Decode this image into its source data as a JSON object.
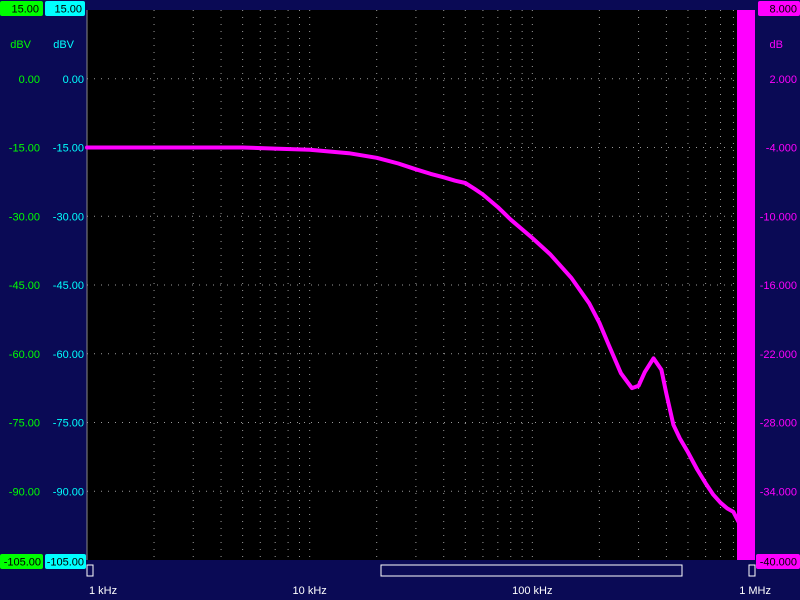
{
  "axes": {
    "left_green": {
      "unit": "dBV",
      "top_badge": "15.00",
      "bottom_badge": "-105.00",
      "ticks": [
        "0.00",
        "-15.00",
        "-30.00",
        "-45.00",
        "-60.00",
        "-75.00",
        "-90.00"
      ]
    },
    "left_cyan": {
      "unit": "dBV",
      "top_badge": "15.00",
      "bottom_badge": "-105.00",
      "ticks": [
        "0.00",
        "-15.00",
        "-30.00",
        "-45.00",
        "-60.00",
        "-75.00",
        "-90.00"
      ]
    },
    "right_magenta": {
      "unit": "dB",
      "top_badge": "8.000",
      "bottom_badge": "-40.000",
      "ticks": [
        "2.000",
        "-4.000",
        "-10.000",
        "-16.000",
        "-22.000",
        "-28.000",
        "-34.000"
      ]
    },
    "x": {
      "tick_labels": [
        "1 kHz",
        "10 kHz",
        "100 kHz",
        "1 MHz"
      ]
    }
  },
  "colors": {
    "background": "#0a0a55",
    "plot_bg": "#000000",
    "green": "#00ff00",
    "cyan": "#00ffff",
    "magenta": "#ff00ff",
    "grid": "#9a9a9a"
  },
  "chart_data": {
    "type": "line",
    "x_scale": "log",
    "xlim": [
      1000,
      1000000
    ],
    "ylim_dB": [
      -40,
      8
    ],
    "ylim_dBV": [
      -105,
      15
    ],
    "series": [
      {
        "x": [
          1000,
          1500,
          2000,
          3000,
          5000,
          7000,
          10000,
          15000,
          20000,
          25000,
          30000,
          35000,
          40000,
          45000,
          50000,
          55000,
          60000,
          70000,
          80000,
          100000,
          120000,
          150000,
          180000,
          200000,
          220000,
          250000,
          280000,
          300000,
          320000,
          350000,
          380000,
          400000,
          430000,
          460000,
          500000,
          550000,
          600000,
          650000,
          700000,
          750000,
          800000,
          850000,
          900000
        ],
        "y": [
          -4.0,
          -4.0,
          -4.0,
          -4.0,
          -4.0,
          -4.1,
          -4.2,
          -4.5,
          -4.9,
          -5.4,
          -5.9,
          -6.3,
          -6.6,
          -6.9,
          -7.1,
          -7.6,
          -8.1,
          -9.2,
          -10.3,
          -11.9,
          -13.3,
          -15.4,
          -17.6,
          -19.3,
          -21.2,
          -23.7,
          -25.0,
          -24.8,
          -23.6,
          -22.4,
          -23.4,
          -25.5,
          -28.2,
          -29.4,
          -30.6,
          -32.1,
          -33.3,
          -34.3,
          -35.0,
          -35.5,
          -35.8,
          -36.8,
          -37.6
        ]
      }
    ]
  }
}
